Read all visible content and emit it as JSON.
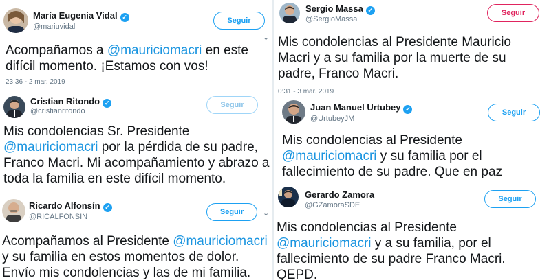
{
  "follow_label": "Seguir",
  "tweets": [
    {
      "name": "María Eugenia Vidal",
      "handle": "@mariuvidal",
      "text_pre": "Acompañamos a ",
      "mention": "@mauriciomacri",
      "text_post": " en este difícil momento. ¡Estamos con vos!",
      "time": "23:36 - 2 mar. 2019"
    },
    {
      "name": "Cristian Ritondo",
      "handle": "@cristianritondo",
      "text_pre": "Mis condolencias Sr. Presidente ",
      "mention": "@mauriciomacri",
      "text_post": " por la pérdida de su padre, Franco Macri. Mi acompañamiento y abrazo a toda la familia en este difícil momento."
    },
    {
      "name": "Ricardo Alfonsín",
      "handle": "@RICALFONSIN",
      "text_pre": "Acompañamos al Presidente ",
      "mention": "@mauriciomacri",
      "text_post": " y su familia en estos momentos de dolor. Envío mis condolencias y las de mi familia."
    },
    {
      "name": "Sergio Massa",
      "handle": "@SergioMassa",
      "text_pre": "Mis condolencias al Presidente Mauricio Macri y a su familia por la muerte de su padre, Franco Macri.",
      "time": "0:31 - 3 mar. 2019"
    },
    {
      "name": "Juan Manuel Urtubey",
      "handle": "@UrtubeyJM",
      "text_pre": "Mis condolencias al Presidente ",
      "mention": "@mauriciomacri",
      "text_post": " y su familia por el fallecimiento de su padre. Que en paz"
    },
    {
      "name": "Gerardo Zamora",
      "handle": "@GZamoraSDE",
      "text_pre": "Mis condolencias al Presidente ",
      "mention": "@mauriciomacri",
      "text_post": " y a su familia, por el fallecimiento de su padre Franco Macri. QEPD."
    }
  ],
  "colors": {
    "link": "#1b95e0",
    "verified": "#1da1f2",
    "follow": "#1da1f2",
    "follow_red": "#e0245e"
  },
  "icons": {
    "verified": "verified-check-icon",
    "chevron": "chevron-down-icon"
  }
}
